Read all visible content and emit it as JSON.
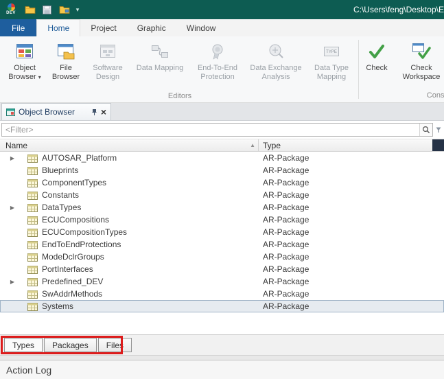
{
  "titlebar": {
    "logo_text": "DEV",
    "path": "C:\\Users\\feng\\Desktop\\E"
  },
  "icons": {
    "dropdown": "▾",
    "close": "×",
    "expand": "▶",
    "sort_asc": "▲"
  },
  "menubar": {
    "tabs": [
      {
        "label": "File"
      },
      {
        "label": "Home"
      },
      {
        "label": "Project"
      },
      {
        "label": "Graphic"
      },
      {
        "label": "Window"
      }
    ]
  },
  "ribbon": {
    "buttons": [
      {
        "label": "Object Browser",
        "enabled": true,
        "dropdown": true
      },
      {
        "label": "File Browser",
        "enabled": true
      },
      {
        "label": "Software Design",
        "enabled": false
      },
      {
        "label": "Data Mapping",
        "enabled": false
      },
      {
        "label": "End-To-End Protection",
        "enabled": false
      },
      {
        "label": "Data Exchange Analysis",
        "enabled": false
      },
      {
        "label": "Data Type Mapping",
        "enabled": false
      },
      {
        "label": "Check",
        "enabled": true
      },
      {
        "label": "Check Workspace",
        "enabled": true
      }
    ],
    "editors_group_label": "Editors",
    "consistency_group_label": "Consister"
  },
  "document_tab": {
    "title": "Object Browser"
  },
  "filter": {
    "placeholder": "<Filter>"
  },
  "grid": {
    "columns": {
      "name": "Name",
      "type": "Type"
    },
    "rows": [
      {
        "name": "AUTOSAR_Platform",
        "type": "AR-Package",
        "expandable": true
      },
      {
        "name": "Blueprints",
        "type": "AR-Package",
        "expandable": false
      },
      {
        "name": "ComponentTypes",
        "type": "AR-Package",
        "expandable": false
      },
      {
        "name": "Constants",
        "type": "AR-Package",
        "expandable": false
      },
      {
        "name": "DataTypes",
        "type": "AR-Package",
        "expandable": true
      },
      {
        "name": "ECUCompositions",
        "type": "AR-Package",
        "expandable": false
      },
      {
        "name": "ECUCompositionTypes",
        "type": "AR-Package",
        "expandable": false
      },
      {
        "name": "EndToEndProtections",
        "type": "AR-Package",
        "expandable": false
      },
      {
        "name": "ModeDclrGroups",
        "type": "AR-Package",
        "expandable": false
      },
      {
        "name": "PortInterfaces",
        "type": "AR-Package",
        "expandable": false
      },
      {
        "name": "Predefined_DEV",
        "type": "AR-Package",
        "expandable": true
      },
      {
        "name": "SwAddrMethods",
        "type": "AR-Package",
        "expandable": false
      },
      {
        "name": "Systems",
        "type": "AR-Package",
        "expandable": false,
        "selected": true
      }
    ]
  },
  "bottom_tabs": [
    {
      "label": "Types"
    },
    {
      "label": "Packages"
    },
    {
      "label": "Files"
    }
  ],
  "annotation": {
    "color": "#dd1b1b"
  },
  "action_log": {
    "title": "Action Log"
  },
  "colors": {
    "titlebar": "#0d5c52",
    "file_tab": "#1e5e9e",
    "accent_blue": "#1f5c99",
    "check_green": "#43a047",
    "header_corner": "#253246"
  }
}
